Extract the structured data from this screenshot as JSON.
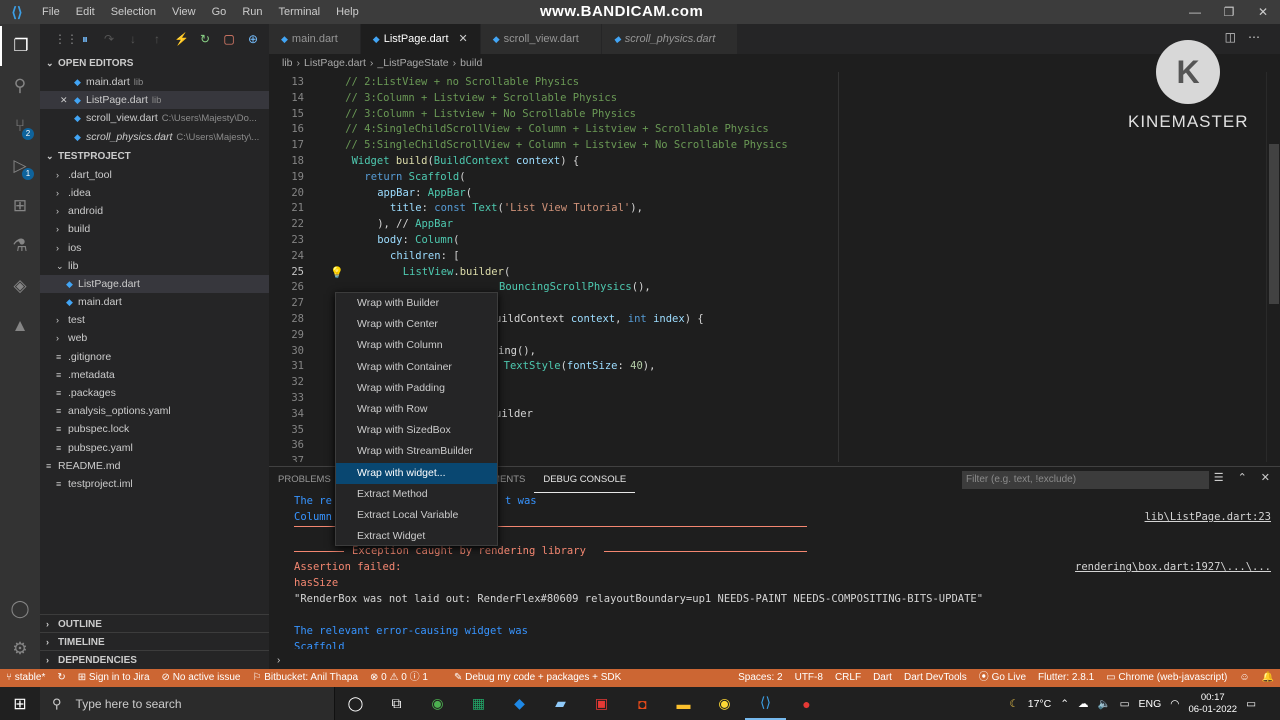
{
  "menu": [
    "File",
    "Edit",
    "Selection",
    "View",
    "Go",
    "Run",
    "Terminal",
    "Help"
  ],
  "watermark": "www.BANDICAM.com",
  "kinemaster": "KINEMASTER",
  "kinemaster_letter": "K",
  "sidebar": {
    "open_editors_title": "OPEN EDITORS",
    "open_editors": [
      {
        "name": "main.dart",
        "path": "lib",
        "italic": false,
        "selected": false,
        "close": ""
      },
      {
        "name": "ListPage.dart",
        "path": "lib",
        "italic": false,
        "selected": true,
        "close": "✕"
      },
      {
        "name": "scroll_view.dart",
        "path": "C:\\Users\\Majesty\\Do...",
        "italic": false,
        "selected": false,
        "close": ""
      },
      {
        "name": "scroll_physics.dart",
        "path": "C:\\Users\\Majesty\\...",
        "italic": true,
        "selected": false,
        "close": ""
      }
    ],
    "project_title": "TESTPROJECT",
    "tree": [
      {
        "name": ".dart_tool",
        "folder": true,
        "indent": 1
      },
      {
        "name": ".idea",
        "folder": true,
        "indent": 1
      },
      {
        "name": "android",
        "folder": true,
        "indent": 1
      },
      {
        "name": "build",
        "folder": true,
        "indent": 1
      },
      {
        "name": "ios",
        "folder": true,
        "indent": 1
      },
      {
        "name": "lib",
        "folder": true,
        "open": true,
        "indent": 1
      },
      {
        "name": "ListPage.dart",
        "folder": false,
        "indent": 2,
        "selected": true
      },
      {
        "name": "main.dart",
        "folder": false,
        "indent": 2
      },
      {
        "name": "test",
        "folder": true,
        "indent": 1
      },
      {
        "name": "web",
        "folder": true,
        "indent": 1
      },
      {
        "name": ".gitignore",
        "folder": false,
        "indent": 1
      },
      {
        "name": ".metadata",
        "folder": false,
        "indent": 1
      },
      {
        "name": ".packages",
        "folder": false,
        "indent": 1
      },
      {
        "name": "analysis_options.yaml",
        "folder": false,
        "indent": 1
      },
      {
        "name": "pubspec.lock",
        "folder": false,
        "indent": 1
      },
      {
        "name": "pubspec.yaml",
        "folder": false,
        "indent": 1
      },
      {
        "name": "README.md",
        "folder": false,
        "indent": 0
      },
      {
        "name": "testproject.iml",
        "folder": false,
        "indent": 1
      }
    ],
    "outline": "OUTLINE",
    "timeline": "TIMELINE",
    "dependencies": "DEPENDENCIES"
  },
  "tabs": [
    {
      "label": "main.dart",
      "active": false,
      "italic": false,
      "close": ""
    },
    {
      "label": "ListPage.dart",
      "active": true,
      "italic": false,
      "close": "✕"
    },
    {
      "label": "scroll_view.dart",
      "active": false,
      "italic": false,
      "close": ""
    },
    {
      "label": "scroll_physics.dart",
      "active": false,
      "italic": true,
      "close": ""
    }
  ],
  "breadcrumbs": [
    "lib",
    "›",
    "ListPage.dart",
    "›",
    "_ListPageState",
    "›",
    "build"
  ],
  "code": [
    {
      "n": "13",
      "t": "// 2:ListView + no Scrollable Physics"
    },
    {
      "n": "14",
      "t": "// 3:Column + Listview + Scrollable Physics"
    },
    {
      "n": "15",
      "t": "// 3:Column + Listview + No Scrollable Physics"
    },
    {
      "n": "16",
      "t": "// 4:SingleChildScrollView + Column + Listview + Scrollable Physics"
    },
    {
      "n": "17",
      "t": "// 5:SingleChildScrollView + Column + Listview + No Scrollable Physics"
    },
    {
      "n": "18",
      "t": "Widget build(BuildContext context) {"
    },
    {
      "n": "19",
      "t": "return Scaffold("
    },
    {
      "n": "20",
      "t": "appBar: AppBar("
    },
    {
      "n": "21",
      "t": "title: const Text('List View Tutorial'),"
    },
    {
      "n": "22",
      "t": "), // AppBar"
    },
    {
      "n": "23",
      "t": "body: Column("
    },
    {
      "n": "24",
      "t": "children: ["
    },
    {
      "n": "25",
      "t": "ListView.builder("
    },
    {
      "n": "26",
      "t": "BouncingScrollPhysics(),"
    },
    {
      "n": "27",
      "t": ""
    },
    {
      "n": "28",
      "t": "uildContext context, int index) {"
    },
    {
      "n": "29",
      "t": ""
    },
    {
      "n": "30",
      "t": "ing(),"
    },
    {
      "n": "31",
      "t": "t TextStyle(fontSize: 40),"
    },
    {
      "n": "32",
      "t": ""
    },
    {
      "n": "33",
      "t": ""
    },
    {
      "n": "34",
      "t": "uilder"
    },
    {
      "n": "35",
      "t": ""
    },
    {
      "n": "36",
      "t": ""
    },
    {
      "n": "37",
      "t": ""
    }
  ],
  "context_menu": [
    "Wrap with Builder",
    "Wrap with Center",
    "Wrap with Column",
    "Wrap with Container",
    "Wrap with Padding",
    "Wrap with Row",
    "Wrap with SizedBox",
    "Wrap with StreamBuilder",
    "Wrap with widget...",
    "Extract Method",
    "Extract Local Variable",
    "Extract Widget"
  ],
  "panel": {
    "tabs": [
      "PROBLEMS",
      "OMMENTS",
      "DEBUG CONSOLE"
    ],
    "filter_placeholder": "Filter (e.g. text, !exclude)",
    "lines": [
      {
        "text": "The re",
        "cls": "blue"
      },
      {
        "text": "Column",
        "cls": "blue"
      },
      {
        "text": "Exception caught by rendering library",
        "cls": "red"
      },
      {
        "text": "Assertion failed:",
        "cls": "red"
      },
      {
        "text": "hasSize",
        "cls": "red"
      },
      {
        "text": "\"RenderBox was not laid out: RenderFlex#80609 relayoutBoundary=up1 NEEDS-PAINT NEEDS-COMPOSITING-BITS-UPDATE\"",
        "cls": "plain"
      },
      {
        "text": "The relevant error-causing widget was",
        "cls": "blue"
      },
      {
        "text": "Scaffold",
        "cls": "blue"
      }
    ],
    "was_text": "t was",
    "link1": "lib\\ListPage.dart:23",
    "link2": "rendering\\box.dart:1927\\...\\..."
  },
  "status": {
    "branch": "stable*",
    "jira": "Sign in to Jira",
    "issue": "No active issue",
    "bitbucket": "Bitbucket: Anil Thapa",
    "problems": "⊗ 0 ⚠ 0 ⓘ 1",
    "debug": "Debug my code + packages + SDK",
    "spaces": "Spaces: 2",
    "encoding": "UTF-8",
    "eol": "CRLF",
    "lang": "Dart",
    "devtools": "Dart DevTools",
    "golive": "Go Live",
    "flutter": "Flutter: 2.8.1",
    "device": "Chrome (web-javascript)"
  },
  "taskbar": {
    "search": "Type here to search",
    "temp": "17°C",
    "lang": "ENG",
    "time": "00:17",
    "date": "06-01-2022"
  }
}
